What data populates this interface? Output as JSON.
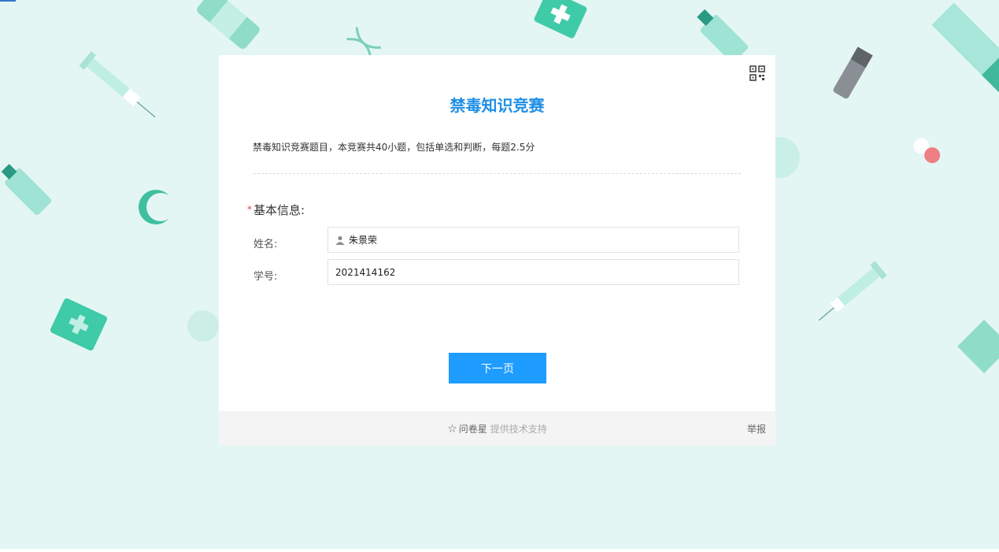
{
  "survey": {
    "title": "禁毒知识竞赛",
    "description": "禁毒知识竞赛题目，本竞赛共40小题，包括单选和判断，每题2.5分",
    "section_required_mark": "*",
    "section_title": "基本信息:"
  },
  "fields": [
    {
      "label": "姓名:",
      "value": "朱景荣",
      "icon": "person-icon"
    },
    {
      "label": "学号:",
      "value": "2021414162"
    }
  ],
  "buttons": {
    "next_label": "下一页"
  },
  "footer": {
    "star_icon": "☆",
    "brand": "问卷星",
    "support": "提供技术支持",
    "report": "举报"
  },
  "colors": {
    "background": "#e4f6f3",
    "title": "#1e8fe6",
    "button": "#1e9cff",
    "required": "#e64545",
    "footer_bg": "#f4f4f4"
  }
}
